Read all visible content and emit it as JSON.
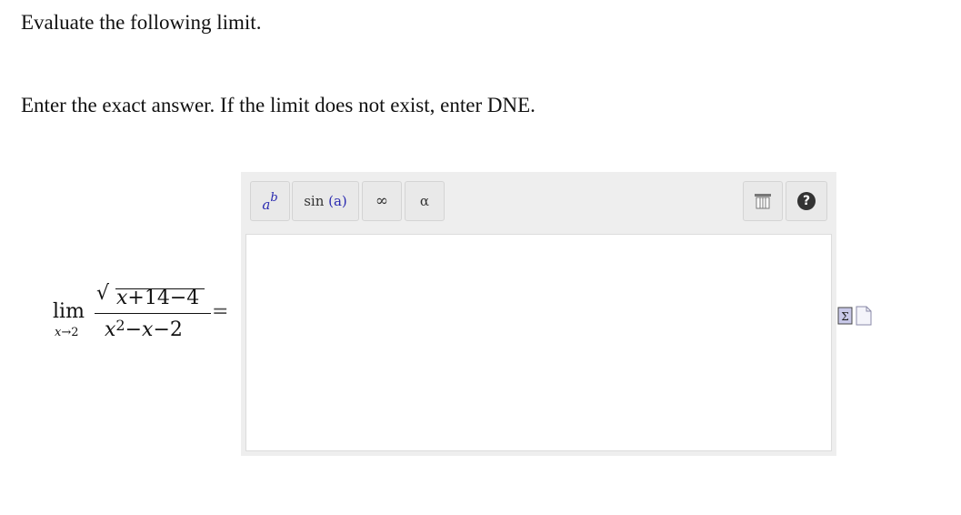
{
  "instructions": {
    "line1": "Evaluate the following limit.",
    "line2": "Enter the exact answer. If the limit does not exist, enter DNE."
  },
  "expression": {
    "lim": "lim",
    "approach_var": "x",
    "arrow": "→",
    "approach_val": "2",
    "numerator": {
      "var": "x",
      "plus": "+14",
      "minus": "−4"
    },
    "denominator": {
      "var": "x",
      "exp": "2",
      "minus_x": "−",
      "x": "x",
      "tail": "−2"
    },
    "equals": "="
  },
  "toolbar": {
    "power": {
      "base": "a",
      "exp": "b",
      "icon": "power-icon"
    },
    "sin_label": "sin",
    "sin_arg": "(a)",
    "infinity": "∞",
    "alpha": "α",
    "table_icon": "table-icon",
    "help_icon": "?"
  },
  "colors": {
    "panel": "#eeeeee",
    "accent_blue": "#2b2bb0",
    "help_bg": "#333333"
  }
}
